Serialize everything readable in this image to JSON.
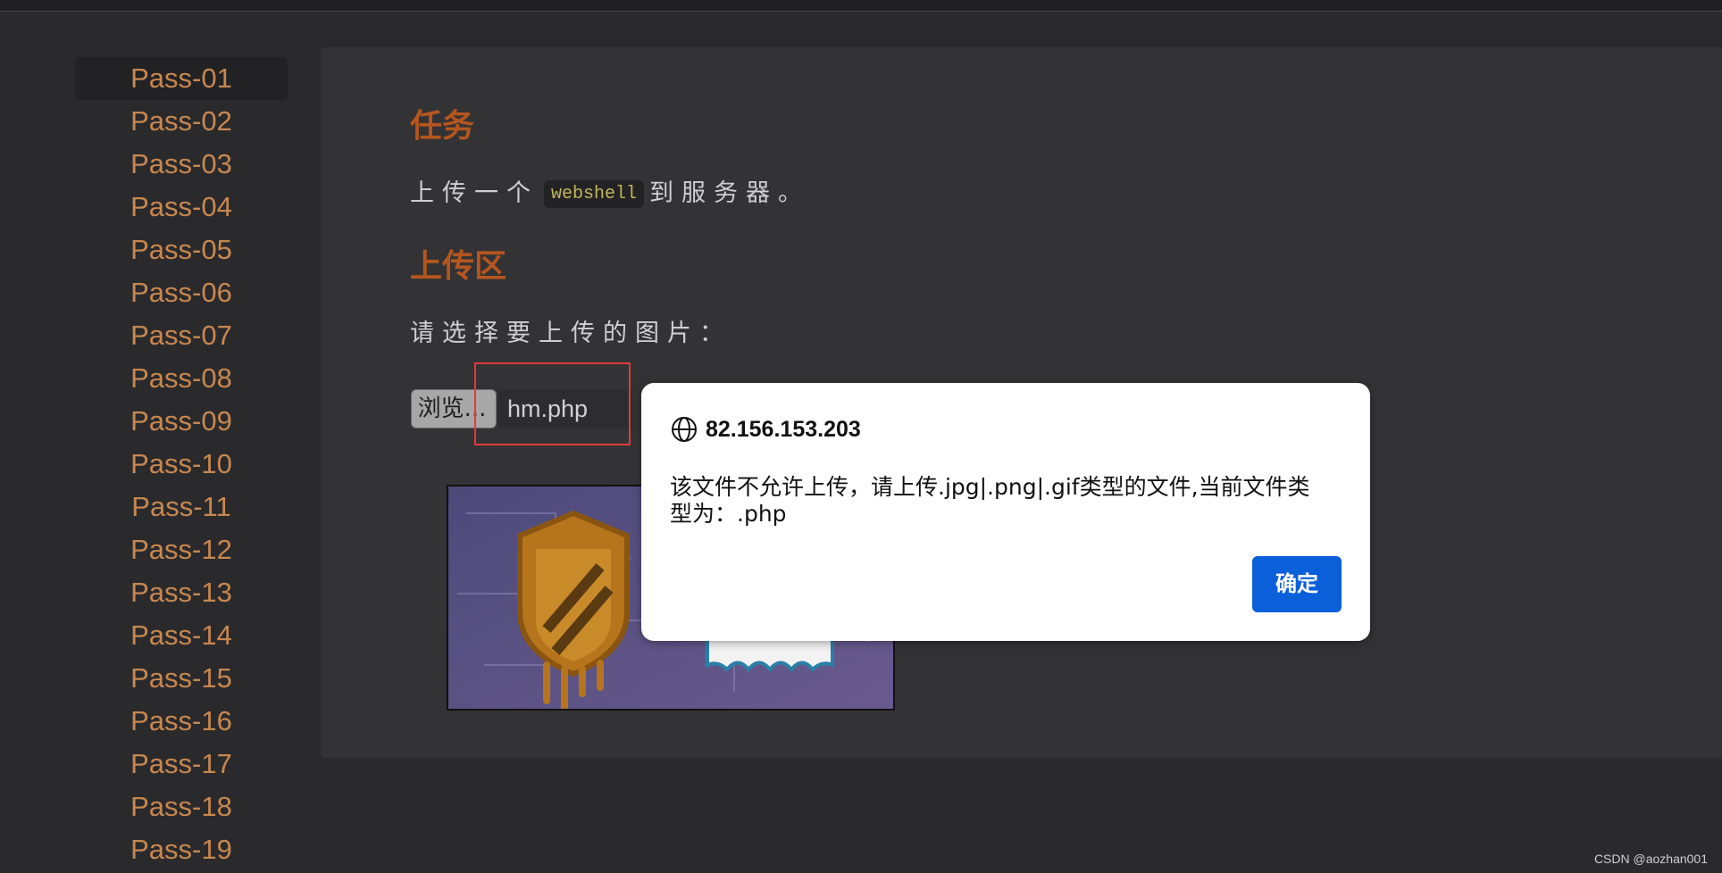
{
  "sidebar": {
    "items": [
      {
        "label": "Pass-01",
        "active": true
      },
      {
        "label": "Pass-02"
      },
      {
        "label": "Pass-03"
      },
      {
        "label": "Pass-04"
      },
      {
        "label": "Pass-05"
      },
      {
        "label": "Pass-06"
      },
      {
        "label": "Pass-07"
      },
      {
        "label": "Pass-08"
      },
      {
        "label": "Pass-09"
      },
      {
        "label": "Pass-10"
      },
      {
        "label": "Pass-11"
      },
      {
        "label": "Pass-12"
      },
      {
        "label": "Pass-13"
      },
      {
        "label": "Pass-14"
      },
      {
        "label": "Pass-15"
      },
      {
        "label": "Pass-16"
      },
      {
        "label": "Pass-17"
      },
      {
        "label": "Pass-18"
      },
      {
        "label": "Pass-19"
      }
    ]
  },
  "main": {
    "task_heading": "任务",
    "task_text_before": "上传一个",
    "task_code": "webshell",
    "task_text_after": "到服务器。",
    "upload_heading": "上传区",
    "upload_prompt": "请选择要上传的图片：",
    "browse_label": "浏览...",
    "file_name": "hm.php"
  },
  "dialog": {
    "title": "82.156.153.203",
    "message": "该文件不允许上传，请上传.jpg|.png|.gif类型的文件,当前文件类型为：.php",
    "ok_label": "确定"
  },
  "watermark": "CSDN @aozhan001",
  "colors": {
    "accent": "#b5561e",
    "sidebar_text": "#c8874f",
    "ok_button": "#0b5fd9",
    "highlight_box": "#e03a3a"
  }
}
